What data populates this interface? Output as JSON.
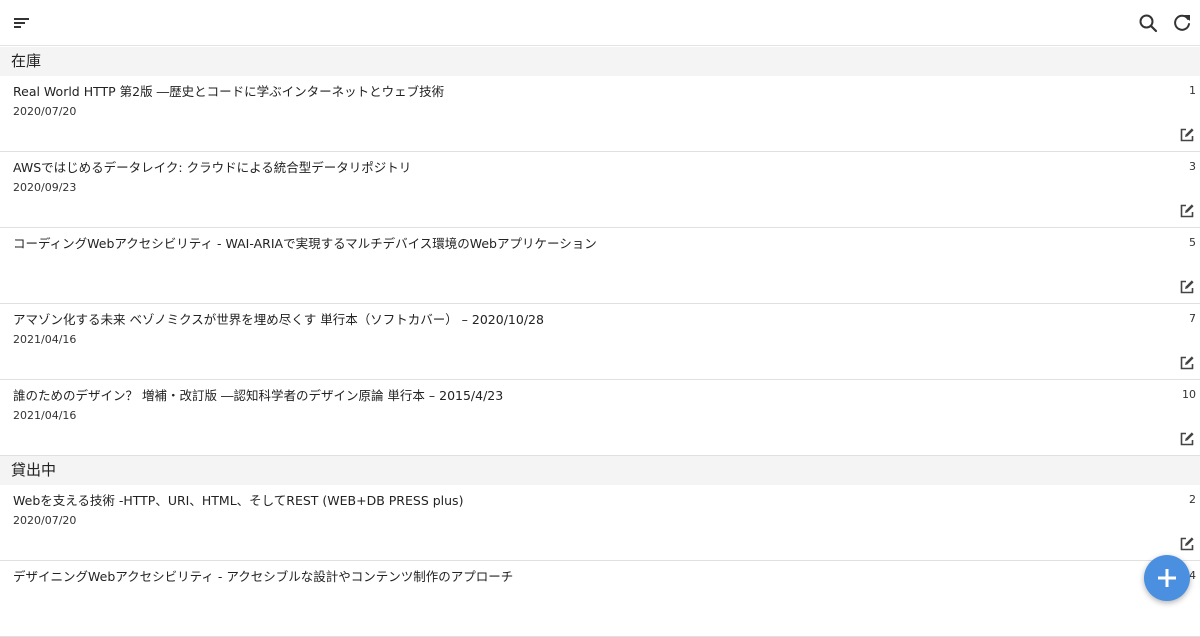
{
  "toolbar": {
    "menu_icon": "sort-lines-icon",
    "search_icon": "search-icon",
    "refresh_icon": "refresh-icon"
  },
  "sections": [
    {
      "title": "在庫",
      "items": [
        {
          "title": "Real World HTTP 第2版 ―歴史とコードに学ぶインターネットとウェブ技術",
          "date": "2020/07/20",
          "count": "1"
        },
        {
          "title": "AWSではじめるデータレイク: クラウドによる統合型データリポジトリ",
          "date": "2020/09/23",
          "count": "3"
        },
        {
          "title": "コーディングWebアクセシビリティ - WAI-ARIAで実現するマルチデバイス環境のWebアプリケーション",
          "date": "",
          "count": "5"
        },
        {
          "title": "アマゾン化する未来 ベゾノミクスが世界を埋め尽くす 単行本（ソフトカバー） – 2020/10/28",
          "date": "2021/04/16",
          "count": "7"
        },
        {
          "title": "誰のためのデザイン？ 増補・改訂版 ―認知科学者のデザイン原論 単行本 – 2015/4/23",
          "date": "2021/04/16",
          "count": "10"
        }
      ]
    },
    {
      "title": "貸出中",
      "items": [
        {
          "title": "Webを支える技術 -HTTP、URI、HTML、そしてREST (WEB+DB PRESS plus)",
          "date": "2020/07/20",
          "count": "2"
        },
        {
          "title": "デザイニングWebアクセシビリティ - アクセシブルな設計やコンテンツ制作のアプローチ",
          "date": "",
          "count": "4"
        }
      ]
    }
  ],
  "fab": {
    "icon": "plus-icon"
  },
  "colors": {
    "fab": "#4a8fe0",
    "section_bg": "#f4f4f4"
  }
}
